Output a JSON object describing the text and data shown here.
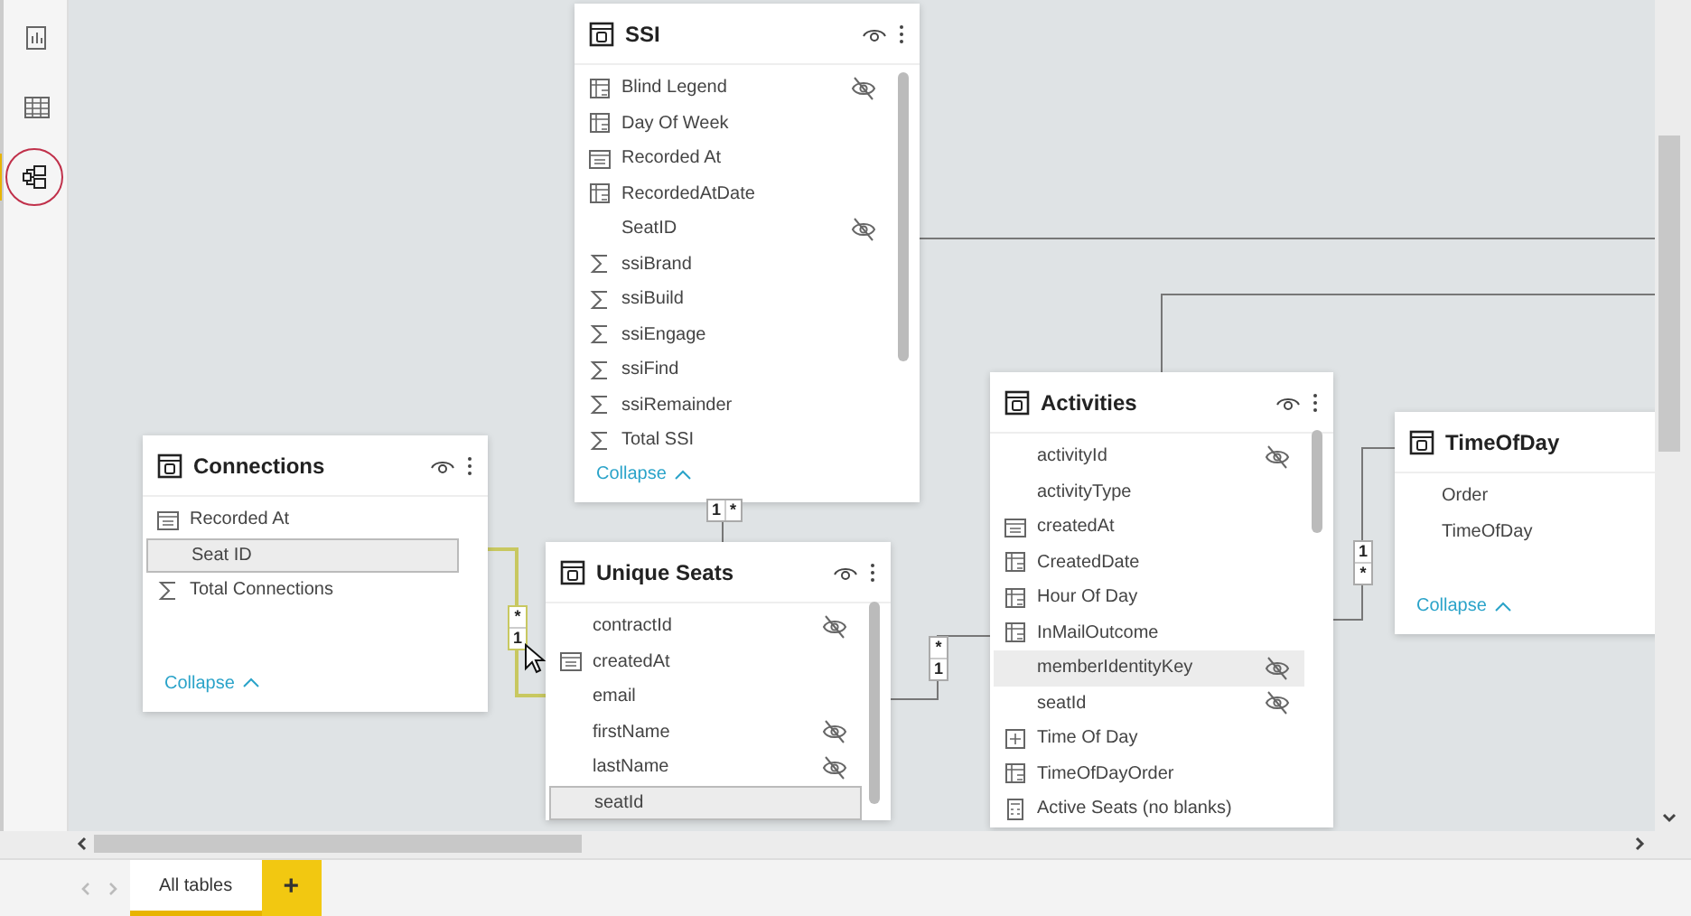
{
  "sidebar": {
    "items": [
      {
        "kind": "report",
        "selected": false
      },
      {
        "kind": "data",
        "selected": false
      },
      {
        "kind": "model",
        "selected": true
      }
    ]
  },
  "tables": [
    {
      "name": "SSI",
      "collapse": "Collapse",
      "fields": [
        {
          "name": "Blind Legend",
          "kind": "calculated",
          "hidden": true,
          "selected": false
        },
        {
          "name": "Day Of Week",
          "kind": "calculated",
          "hidden": false,
          "selected": false
        },
        {
          "name": "Recorded At",
          "kind": "date",
          "hidden": false,
          "selected": false
        },
        {
          "name": "RecordedAtDate",
          "kind": "calculated",
          "hidden": false,
          "selected": false
        },
        {
          "name": "SeatID",
          "kind": "plain",
          "hidden": true,
          "selected": false
        },
        {
          "name": "ssiBrand",
          "kind": "sum",
          "hidden": false,
          "selected": false
        },
        {
          "name": "ssiBuild",
          "kind": "sum",
          "hidden": false,
          "selected": false
        },
        {
          "name": "ssiEngage",
          "kind": "sum",
          "hidden": false,
          "selected": false
        },
        {
          "name": "ssiFind",
          "kind": "sum",
          "hidden": false,
          "selected": false
        },
        {
          "name": "ssiRemainder",
          "kind": "sum",
          "hidden": false,
          "selected": false
        },
        {
          "name": "Total SSI",
          "kind": "sum",
          "hidden": false,
          "selected": false
        }
      ]
    },
    {
      "name": "Connections",
      "collapse": "Collapse",
      "fields": [
        {
          "name": "Recorded At",
          "kind": "date",
          "hidden": false,
          "selected": false
        },
        {
          "name": "Seat ID",
          "kind": "plain",
          "hidden": false,
          "selected": true
        },
        {
          "name": "Total Connections",
          "kind": "sum",
          "hidden": false,
          "selected": false
        }
      ]
    },
    {
      "name": "Unique Seats",
      "fields": [
        {
          "name": "contractId",
          "kind": "plain",
          "hidden": true,
          "selected": false
        },
        {
          "name": "createdAt",
          "kind": "date",
          "hidden": false,
          "selected": false
        },
        {
          "name": "email",
          "kind": "plain",
          "hidden": false,
          "selected": false
        },
        {
          "name": "firstName",
          "kind": "plain",
          "hidden": true,
          "selected": false
        },
        {
          "name": "lastName",
          "kind": "plain",
          "hidden": true,
          "selected": false
        },
        {
          "name": "seatId",
          "kind": "plain",
          "hidden": false,
          "selected": true
        }
      ]
    },
    {
      "name": "Activities",
      "fields": [
        {
          "name": "activityId",
          "kind": "plain",
          "hidden": true,
          "selected": false
        },
        {
          "name": "activityType",
          "kind": "plain",
          "hidden": false,
          "selected": false
        },
        {
          "name": "createdAt",
          "kind": "date",
          "hidden": false,
          "selected": false
        },
        {
          "name": "CreatedDate",
          "kind": "calculated",
          "hidden": false,
          "selected": false
        },
        {
          "name": "Hour Of Day",
          "kind": "calculated",
          "hidden": false,
          "selected": false
        },
        {
          "name": "InMailOutcome",
          "kind": "calculated",
          "hidden": false,
          "selected": false
        },
        {
          "name": "memberIdentityKey",
          "kind": "plain",
          "hidden": true,
          "selected": true
        },
        {
          "name": "seatId",
          "kind": "plain",
          "hidden": true,
          "selected": false
        },
        {
          "name": "Time Of Day",
          "kind": "hierarchy",
          "hidden": false,
          "selected": false
        },
        {
          "name": "TimeOfDayOrder",
          "kind": "calculated",
          "hidden": false,
          "selected": false
        },
        {
          "name": "Active Seats (no blanks)",
          "kind": "measure",
          "hidden": false,
          "selected": false
        }
      ]
    },
    {
      "name": "TimeOfDay",
      "collapse": "Collapse",
      "fields": [
        {
          "name": "Order",
          "kind": "plain",
          "hidden": false,
          "selected": false
        },
        {
          "name": "TimeOfDay",
          "kind": "plain",
          "hidden": false,
          "selected": false
        }
      ]
    }
  ],
  "relationships": [
    {
      "labels": [
        "1",
        "*"
      ],
      "selected": false
    },
    {
      "labels": [
        "*",
        "1"
      ],
      "selected": true
    },
    {
      "labels": [
        "*",
        "1"
      ],
      "selected": false
    },
    {
      "labels": [
        "1",
        "*"
      ],
      "selected": false
    }
  ],
  "tabs": [
    {
      "label": "All tables",
      "selected": true
    }
  ],
  "add_tab": "+"
}
